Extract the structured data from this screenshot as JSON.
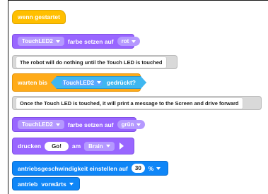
{
  "blocks": {
    "when_started": "wenn gestartet",
    "set_color1": {
      "device": "TouchLED2",
      "text": "farbe setzen auf",
      "color": "rot"
    },
    "comment1": "The robot will do nothing until the Touch LED is touched",
    "wait_until": {
      "text": "warten bis",
      "device": "TouchLED2",
      "cond": "gedrückt?"
    },
    "comment2": "Once the Touch LED is touched,  it will print a message to the Screen and drive forward",
    "set_color2": {
      "device": "TouchLED2",
      "text": "farbe setzen auf",
      "color": "grün"
    },
    "print": {
      "text": "drucken",
      "value": "Go!",
      "on": "am",
      "target": "Brain"
    },
    "drive_velocity": {
      "text": "antriebsgeschwindigkeit einstellen auf",
      "value": "30",
      "unit": "%"
    },
    "drive": {
      "text": "antrieb",
      "dir": "vorwärts"
    }
  },
  "colors": {
    "events": "#ffbf00",
    "looks": "#9966ff",
    "control": "#ffab19",
    "sensing": "#3fb7f0",
    "motion": "#0f86f7",
    "comment": "#d9d9d9"
  }
}
